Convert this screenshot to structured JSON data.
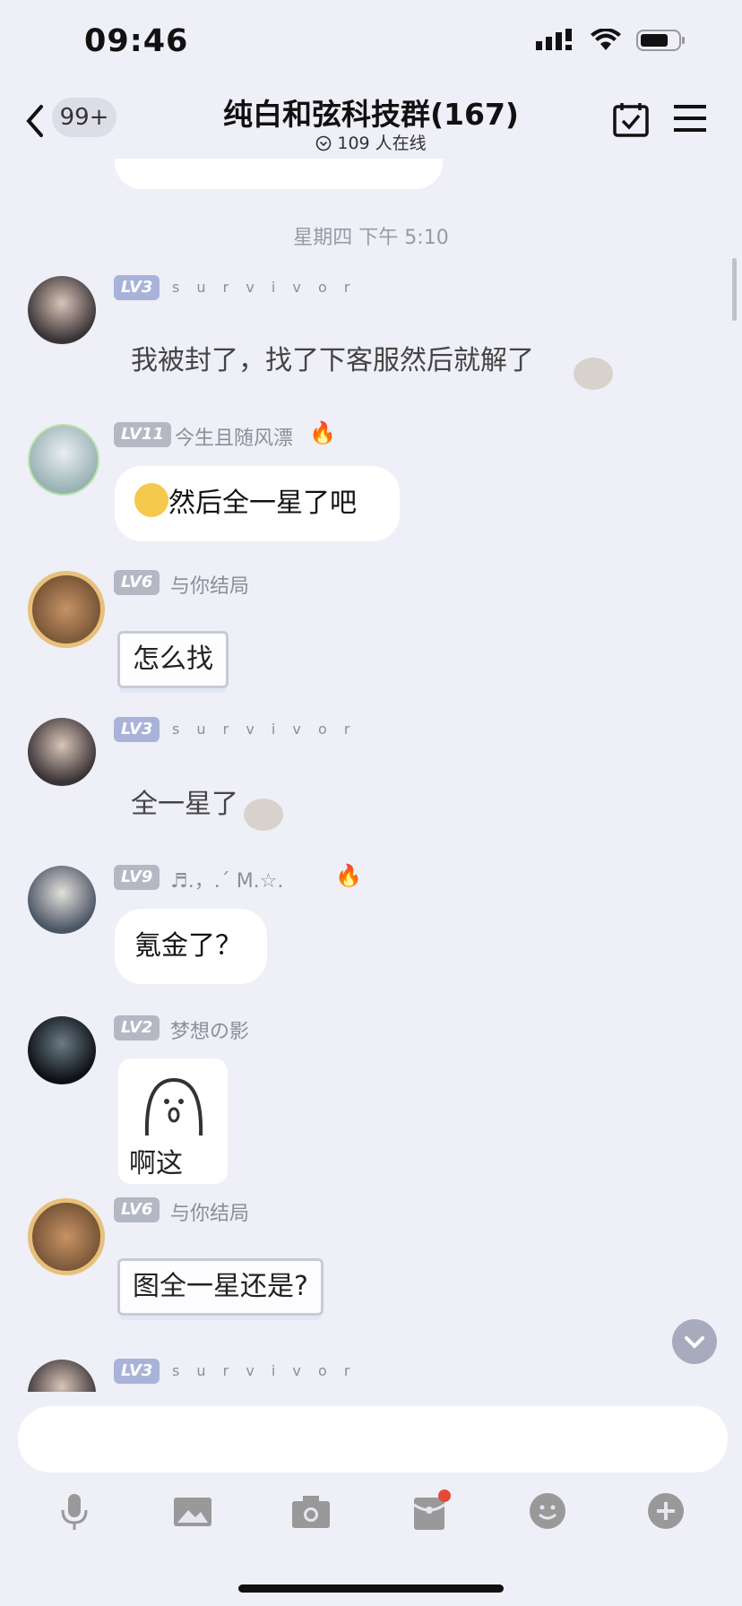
{
  "status": {
    "time": "09:46"
  },
  "header": {
    "unread_badge": "99+",
    "title": "纯白和弦科技群(167)",
    "online": "109 人在线"
  },
  "chat": {
    "time_divider": "星期四 下午 5:10",
    "messages": [
      {
        "level": "LV3",
        "name": "s u r v i v o r",
        "text": "我被封了，找了下客服然后就解了",
        "style": "plain"
      },
      {
        "level": "LV11",
        "name": "今生且随风漂",
        "text": "然后全一星了吧",
        "style": "bubble",
        "emoji": "🫢"
      },
      {
        "level": "LV6",
        "name": "与你结局",
        "text": "怎么找",
        "style": "frame"
      },
      {
        "level": "LV3",
        "name": "s u r v i v o r",
        "text": "全一星了",
        "style": "plain"
      },
      {
        "level": "LV9",
        "name": "♬.，.ˊ M.☆.",
        "text": "氪金了？",
        "style": "bubble"
      },
      {
        "level": "LV2",
        "name": "梦想の影",
        "text": "啊这",
        "style": "sticker"
      },
      {
        "level": "LV6",
        "name": "与你结局",
        "text": "图全一星还是?",
        "style": "frame"
      },
      {
        "level": "LV3",
        "name": "s u r v i v o r",
        "text": "",
        "style": "partial"
      }
    ]
  },
  "input": {
    "placeholder": ""
  },
  "toolbar": [
    "mic-icon",
    "image-icon",
    "camera-icon",
    "redpacket-icon",
    "emoji-icon",
    "plus-icon"
  ]
}
